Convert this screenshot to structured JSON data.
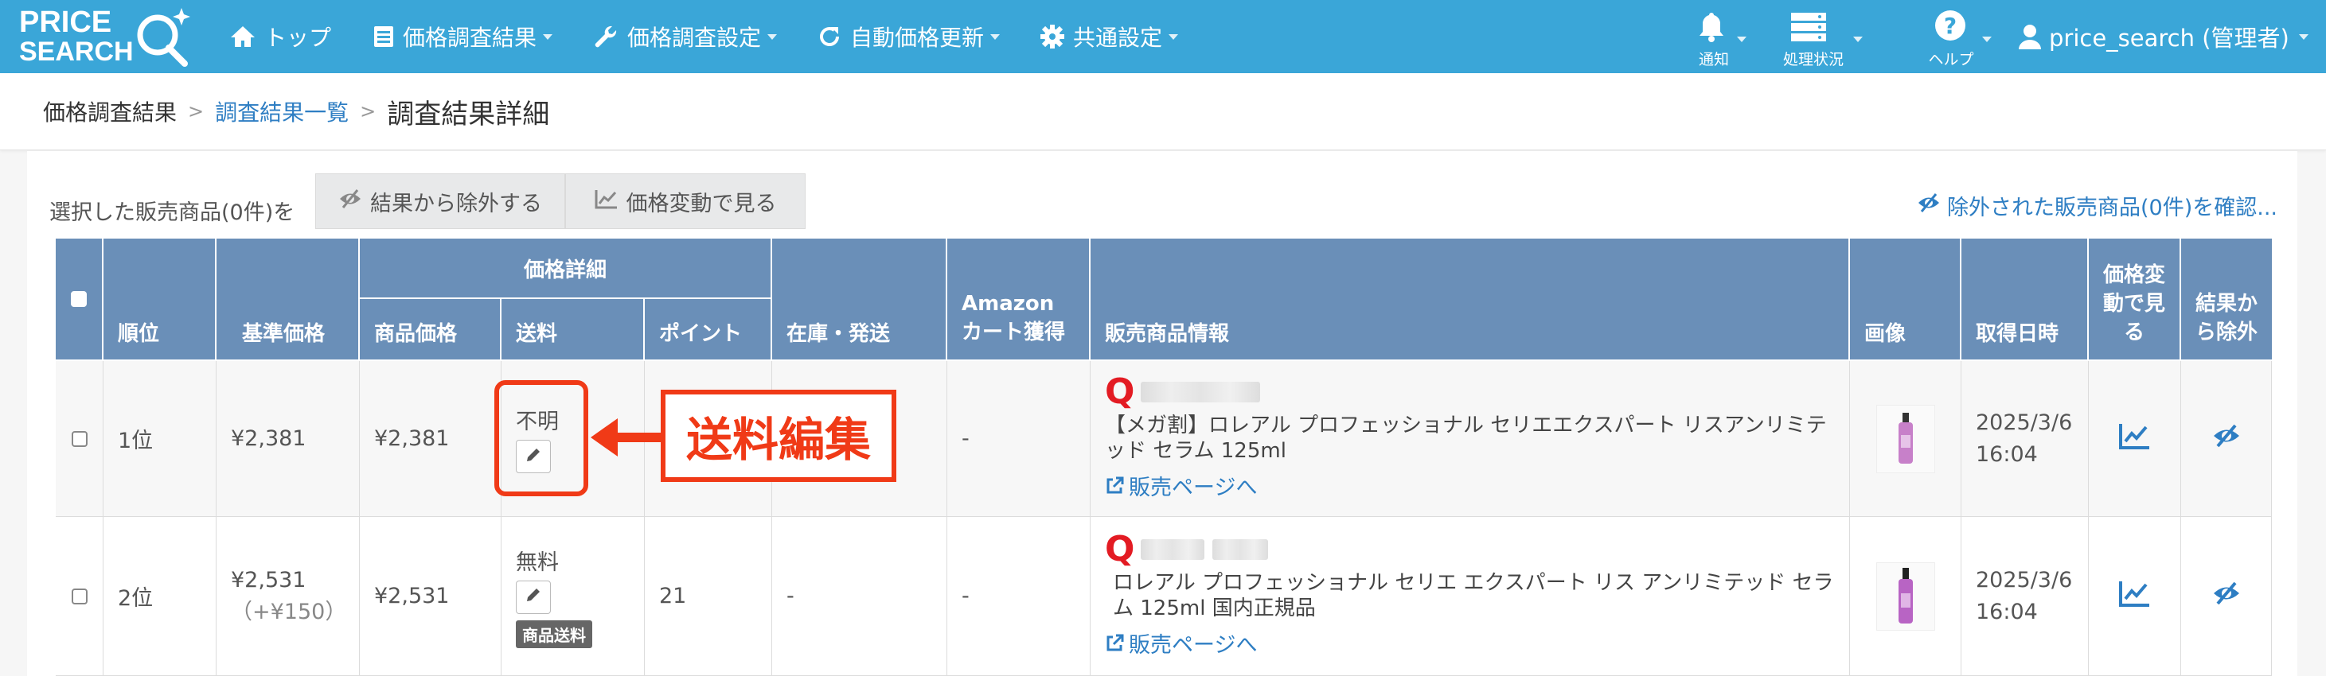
{
  "nav": {
    "logo_text_top": "PRICE",
    "logo_text_bottom": "SEARCH",
    "top": "トップ",
    "results": "価格調査結果",
    "settings": "価格調査設定",
    "auto_update": "自動価格更新",
    "common": "共通設定",
    "notify": "通知",
    "status": "処理状況",
    "help": "ヘルプ",
    "user": "price_search (管理者)"
  },
  "breadcrumb": {
    "root": "価格調査結果",
    "list": "調査結果一覧",
    "current": "調査結果詳細"
  },
  "actions": {
    "selected_label": "選択した販売商品(0件)を",
    "exclude_btn": "結果から除外する",
    "price_change_btn": "価格変動で見る",
    "excluded_link": "除外された販売商品(0件)を確認..."
  },
  "table": {
    "headers": {
      "rank": "順位",
      "base_price": "基準価格",
      "price_detail": "価格詳細",
      "item_price": "商品価格",
      "shipping": "送料",
      "point": "ポイント",
      "stock": "在庫・発送",
      "amazon_l1": "Amazon",
      "amazon_l2": "カート獲得",
      "product_info": "販売商品情報",
      "image": "画像",
      "acquired": "取得日時",
      "price_view_l1": "価格変",
      "price_view_l2": "動で見",
      "price_view_l3": "る",
      "exclude_l1": "結果か",
      "exclude_l2": "ら除外"
    },
    "rows": [
      {
        "rank": "1位",
        "base_price": "¥2,381",
        "base_diff": "",
        "item_price": "¥2,381",
        "shipping": "不明",
        "shipping_badge": "",
        "point": "",
        "stock": "",
        "amazon": "-",
        "product_name": "【メガ割】ロレアル プロフェッショナル セリエエクスパート リスアンリミテッド セラム 125ml",
        "sale_link": "販売ページへ",
        "date": "2025/3/6",
        "time": "16:04"
      },
      {
        "rank": "2位",
        "base_price": "¥2,531",
        "base_diff": "（+¥150）",
        "item_price": "¥2,531",
        "shipping": "無料",
        "shipping_badge": "商品送料",
        "point": "21",
        "stock": "-",
        "amazon": "-",
        "product_name": "ロレアル プロフェッショナル セリエ エクスパート リス アンリミテッド セラム 125ml 国内正規品",
        "sale_link": "販売ページへ",
        "date": "2025/3/6",
        "time": "16:04"
      }
    ]
  },
  "annotation": {
    "label": "送料編集"
  },
  "colors": {
    "nav_bg": "#3aa6d8",
    "table_header": "#6a8fb8",
    "annotation": "#f03a17",
    "link": "#2e7ec3"
  },
  "icons": [
    "home-icon",
    "list-icon",
    "wrench-icon",
    "refresh-icon",
    "gear-icon",
    "bell-icon",
    "server-icon",
    "help-icon",
    "user-icon",
    "eye-slash-icon",
    "line-chart-icon",
    "pencil-icon",
    "external-link-icon"
  ]
}
